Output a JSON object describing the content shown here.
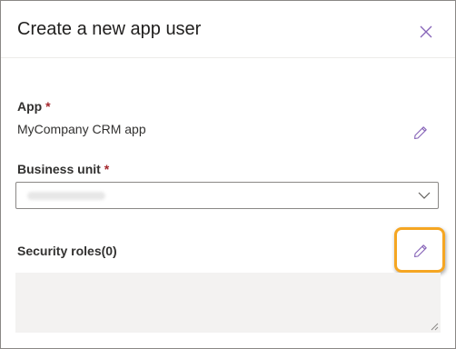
{
  "dialog": {
    "title": "Create a new app user",
    "close_icon": "close-icon"
  },
  "app": {
    "label": "App",
    "required_marker": "*",
    "value": "MyCompany CRM app",
    "edit_icon": "pencil-icon"
  },
  "business_unit": {
    "label": "Business unit",
    "required_marker": "*",
    "selected_value": "",
    "value_obscured": true,
    "dropdown_icon": "chevron-down-icon"
  },
  "security_roles": {
    "label": "Security roles(0)",
    "edit_icon": "pencil-icon",
    "highlighted": true,
    "list_value": ""
  },
  "colors": {
    "accent": "#8764b8",
    "required": "#a4262c",
    "highlight": "#f5a623",
    "field_background": "#f3f2f1"
  }
}
